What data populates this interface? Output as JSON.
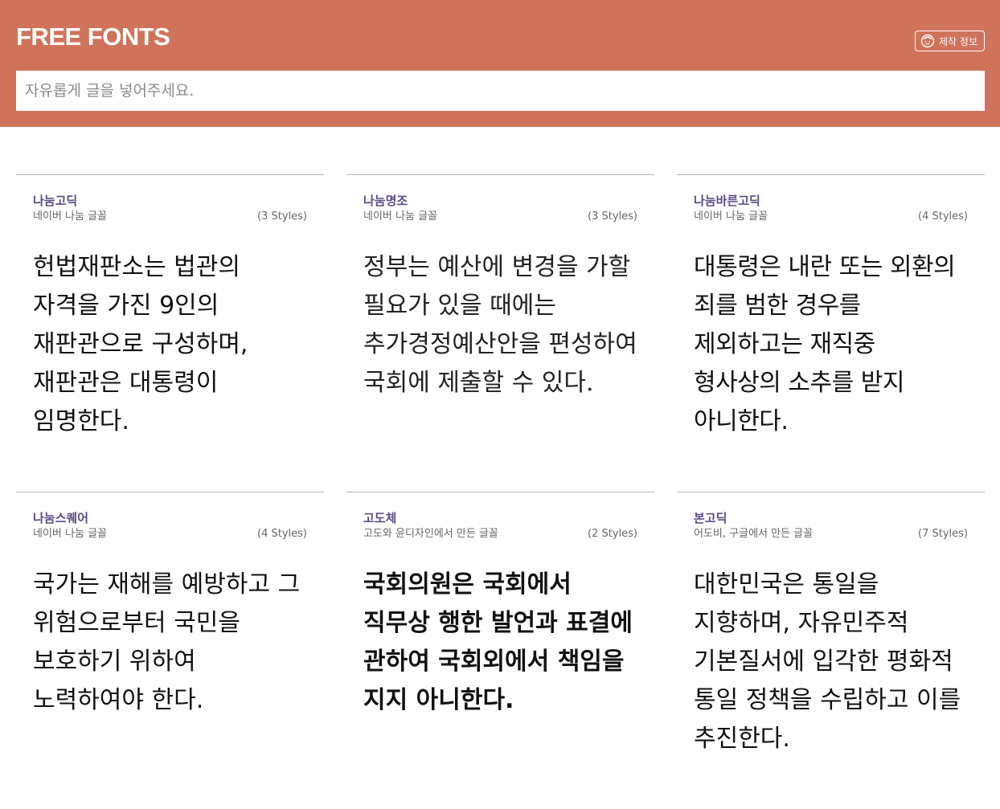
{
  "header": {
    "logo": "FREE FONTS",
    "credits_label": "제작 정보",
    "credits_icon": "face-icon",
    "search_placeholder": "자유롭게 글을 넣어주세요.",
    "background": "#cf735b"
  },
  "fonts": [
    {
      "name": "나눔고딕",
      "source": "네이버 나눔 글꼴",
      "styles": "(3 Styles)",
      "sample": "헌법재판소는 법관의 자격을 가진 9인의 재판관으로 구성하며, 재판관은 대통령이 임명한다."
    },
    {
      "name": "나눔명조",
      "source": "네이버 나눔 글꼴",
      "styles": "(3 Styles)",
      "sample": "정부는 예산에 변경을 가할 필요가 있을 때에는 추가경정예산안을 편성하여 국회에 제출할 수 있다."
    },
    {
      "name": "나눔바른고딕",
      "source": "네이버 나눔 글꼴",
      "styles": "(4 Styles)",
      "sample": "대통령은 내란 또는 외환의 죄를 범한 경우를 제외하고는 재직중 형사상의 소추를 받지 아니한다."
    },
    {
      "name": "나눔스퀘어",
      "source": "네이버 나눔 글꼴",
      "styles": "(4 Styles)",
      "sample": "국가는 재해를 예방하고 그 위험으로부터 국민을 보호하기 위하여 노력하여야 한다."
    },
    {
      "name": "고도체",
      "source": "고도와 윤디자인에서 만든 글꼴",
      "styles": "(2 Styles)",
      "sample": "국회의원은 국회에서 직무상 행한 발언과 표결에 관하여 국회외에서 책임을 지지 아니한다."
    },
    {
      "name": "본고딕",
      "source": "어도비, 구글에서 만든 글꼴",
      "styles": "(7 Styles)",
      "sample": "대한민국은 통일을 지향하며, 자유민주적 기본질서에 입각한 평화적 통일 정책을 수립하고 이를 추진한다."
    }
  ]
}
